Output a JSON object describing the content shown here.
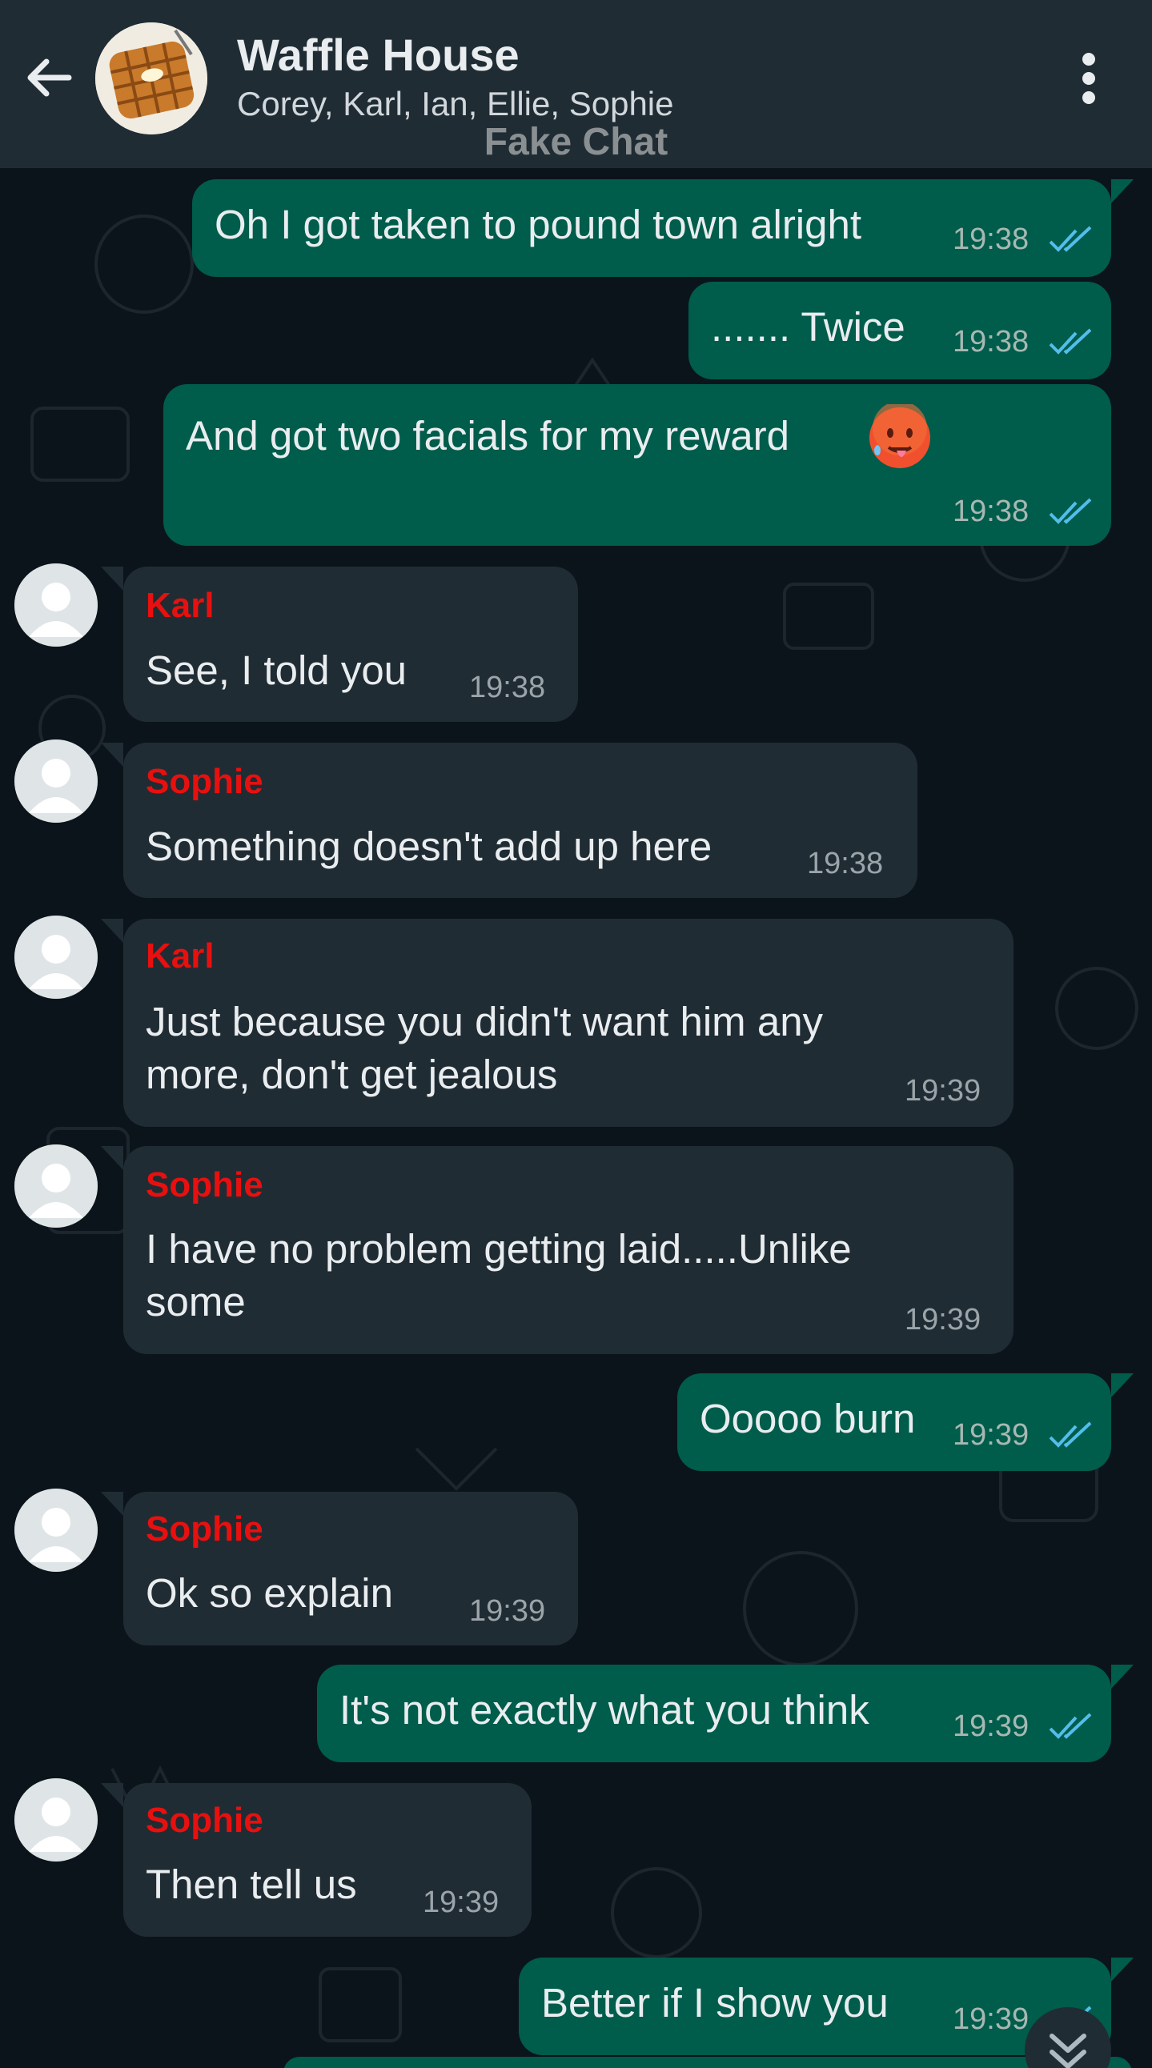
{
  "header": {
    "title": "Waffle House",
    "subtitle": "Corey, Karl, Ian, Ellie, Sophie",
    "watermark": "Fake Chat",
    "back_icon": "arrow-left-icon",
    "menu_icon": "more-vertical-icon"
  },
  "colors": {
    "outgoing_bubble": "#005c4b",
    "incoming_bubble": "#202c33",
    "sender_name": "#e8100f",
    "read_ticks": "#53bdeb",
    "header_bg": "#1f2c34",
    "chat_bg": "#0b141a"
  },
  "messages": [
    {
      "direction": "out",
      "text": "Oh I got taken to pound town alright",
      "time": "19:38",
      "status": "read"
    },
    {
      "direction": "out",
      "text": "....... Twice",
      "time": "19:38",
      "status": "read"
    },
    {
      "direction": "out",
      "text": "And got two facials for my reward",
      "emoji": "hot-face-emoji",
      "time": "19:38",
      "status": "read"
    },
    {
      "direction": "in",
      "sender": "Karl",
      "text": "See, I told you",
      "time": "19:38"
    },
    {
      "direction": "in",
      "sender": "Sophie",
      "text": "Something doesn't add up here",
      "time": "19:38"
    },
    {
      "direction": "in",
      "sender": "Karl",
      "lines": [
        "Just because you didn't want him any",
        "more, don't get jealous"
      ],
      "time": "19:39"
    },
    {
      "direction": "in",
      "sender": "Sophie",
      "lines": [
        "I have no problem getting laid.....Unlike",
        "some"
      ],
      "time": "19:39"
    },
    {
      "direction": "out",
      "text": "Ooooo burn",
      "time": "19:39",
      "status": "read"
    },
    {
      "direction": "in",
      "sender": "Sophie",
      "text": "Ok so explain",
      "time": "19:39"
    },
    {
      "direction": "out",
      "text": "It's not exactly what you think",
      "time": "19:39",
      "status": "read"
    },
    {
      "direction": "in",
      "sender": "Sophie",
      "text": "Then tell us",
      "time": "19:39"
    },
    {
      "direction": "out",
      "text": "Better if I show you",
      "time": "19:39",
      "status": "read"
    }
  ],
  "scroll_button_icon": "double-chevron-down-icon"
}
